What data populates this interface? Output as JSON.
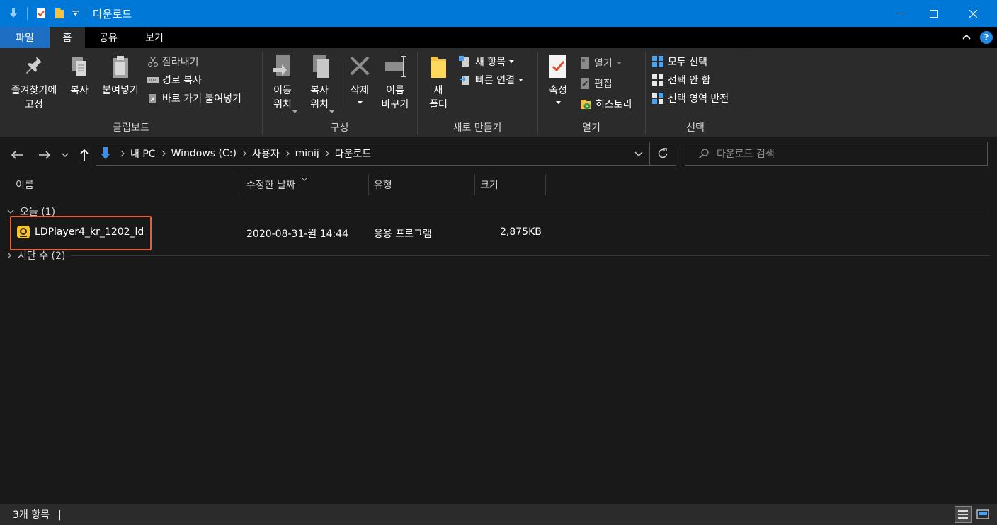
{
  "window": {
    "title": "다운로드",
    "accent": "#0078d7"
  },
  "ribbon_tabs": [
    {
      "label": "파일"
    },
    {
      "label": "홈"
    },
    {
      "label": "공유"
    },
    {
      "label": "보기"
    }
  ],
  "ribbon": {
    "clipboard": {
      "label": "클립보드",
      "pin": "즐겨찾기에\n고정",
      "copy": "복사",
      "paste": "붙여넣기",
      "cut": "잘라내기",
      "copy_path": "경로 복사",
      "paste_shortcut": "바로 가기 붙여넣기"
    },
    "organize": {
      "label": "구성",
      "move_to": "이동\n위치",
      "copy_to": "복사\n위치",
      "delete": "삭제",
      "rename": "이름\n바꾸기"
    },
    "new": {
      "label": "새로 만들기",
      "new_folder": "새\n폴더",
      "new_item": "새 항목",
      "easy_access": "빠른 연결"
    },
    "open": {
      "label": "열기",
      "properties": "속성",
      "open": "열기",
      "edit": "편집",
      "history": "히스토리"
    },
    "select": {
      "label": "선택",
      "select_all": "모두 선택",
      "select_none": "선택 안 함",
      "invert": "선택 영역 반전"
    }
  },
  "address": {
    "crumbs": [
      "내 PC",
      "Windows (C:)",
      "사용자",
      "minij",
      "다운로드"
    ],
    "search_placeholder": "다운로드 검색"
  },
  "columns": [
    "이름",
    "수정한 날짜",
    "유형",
    "크기"
  ],
  "groups": [
    {
      "header": "오늘 (1)",
      "expanded": true,
      "files": [
        {
          "name": "LDPlayer4_kr_1202_ld",
          "modified": "2020-08-31-월 14:44",
          "type": "응용 프로그램",
          "size": "2,875KB"
        }
      ]
    },
    {
      "header": "시단 수 (2)",
      "expanded": false,
      "files": []
    }
  ],
  "status": {
    "count": "3개 항목"
  }
}
